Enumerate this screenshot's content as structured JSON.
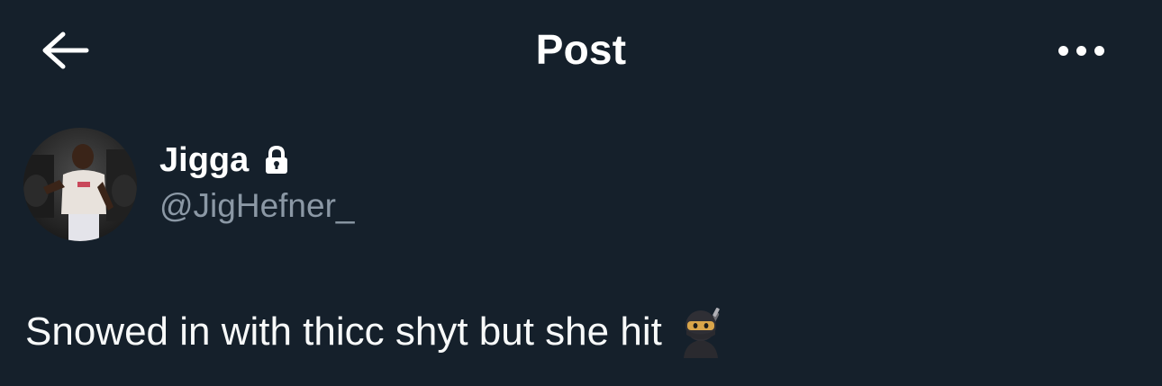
{
  "header": {
    "title": "Post",
    "back_icon": "arrow-left-icon",
    "more_icon": "more-horizontal-icon"
  },
  "author": {
    "display_name": "Jigga",
    "handle": "@JigHefner_",
    "protected_icon": "lock-icon",
    "avatar_icon": "profile-photo"
  },
  "post": {
    "text": "Snowed in with thicc shyt but she hit",
    "emoji": "ninja-emoji"
  },
  "colors": {
    "background": "#15202b",
    "primary_text": "#ffffff",
    "secondary_text": "#8b98a5"
  }
}
